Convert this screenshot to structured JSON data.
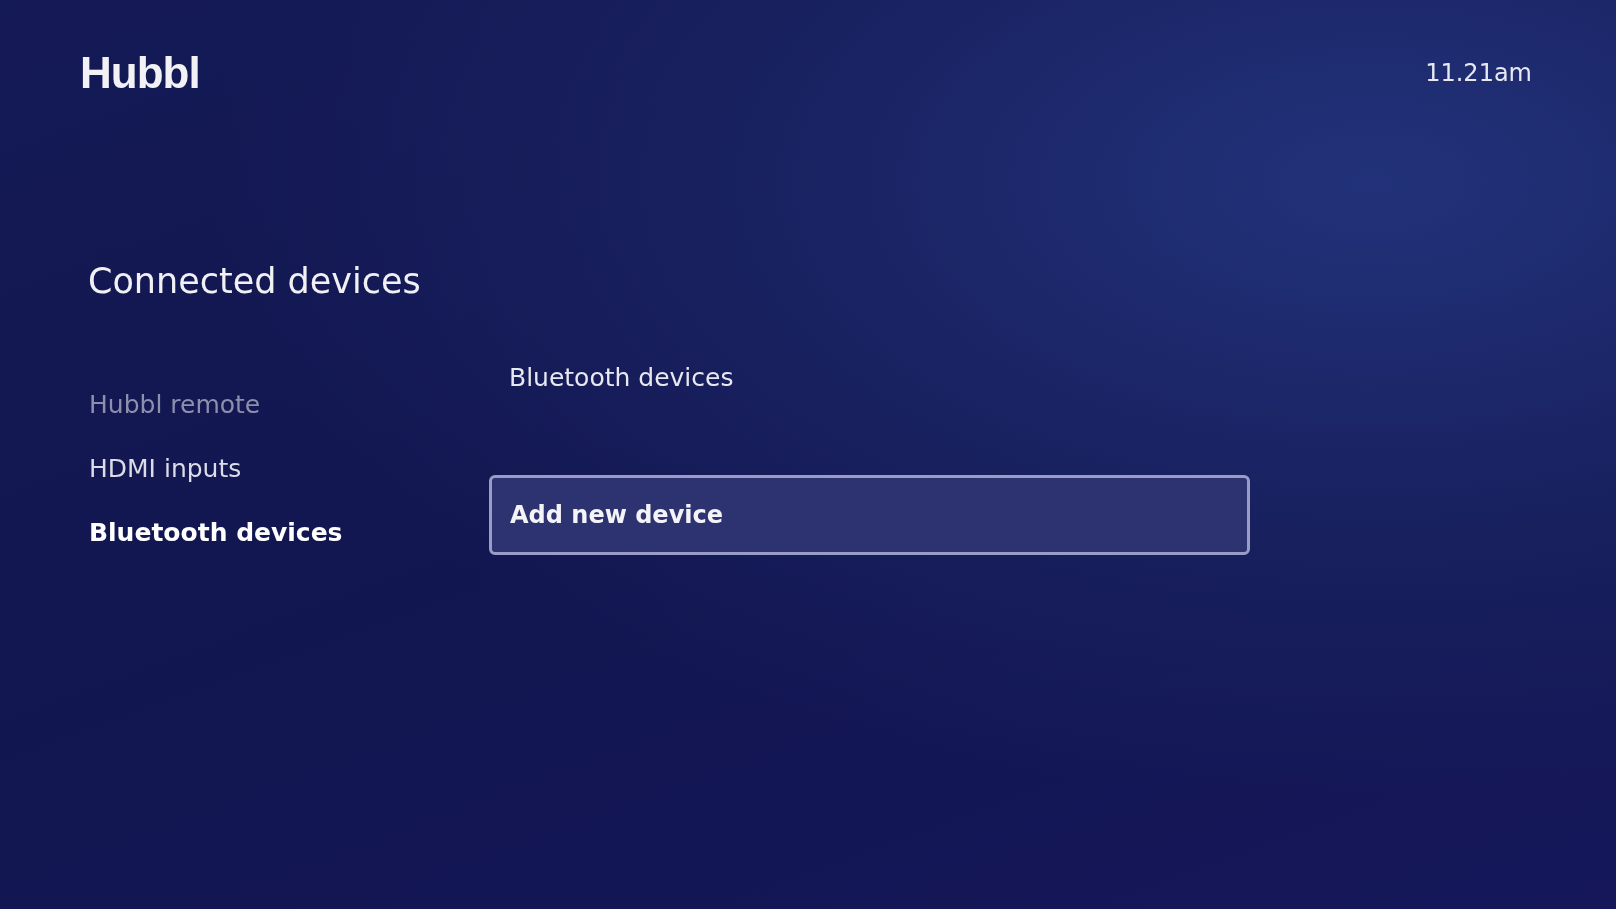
{
  "header": {
    "logo": "Hubbl",
    "time": "11.21am"
  },
  "page_title": "Connected devices",
  "sidebar": {
    "items": [
      {
        "label": "Hubbl remote",
        "selected": false,
        "disabled": true
      },
      {
        "label": "HDMI inputs",
        "selected": false,
        "disabled": false
      },
      {
        "label": "Bluetooth devices",
        "selected": true,
        "disabled": false
      }
    ]
  },
  "panel": {
    "heading": "Bluetooth devices",
    "buttons": [
      {
        "label": "Add new device",
        "focused": true
      }
    ]
  }
}
